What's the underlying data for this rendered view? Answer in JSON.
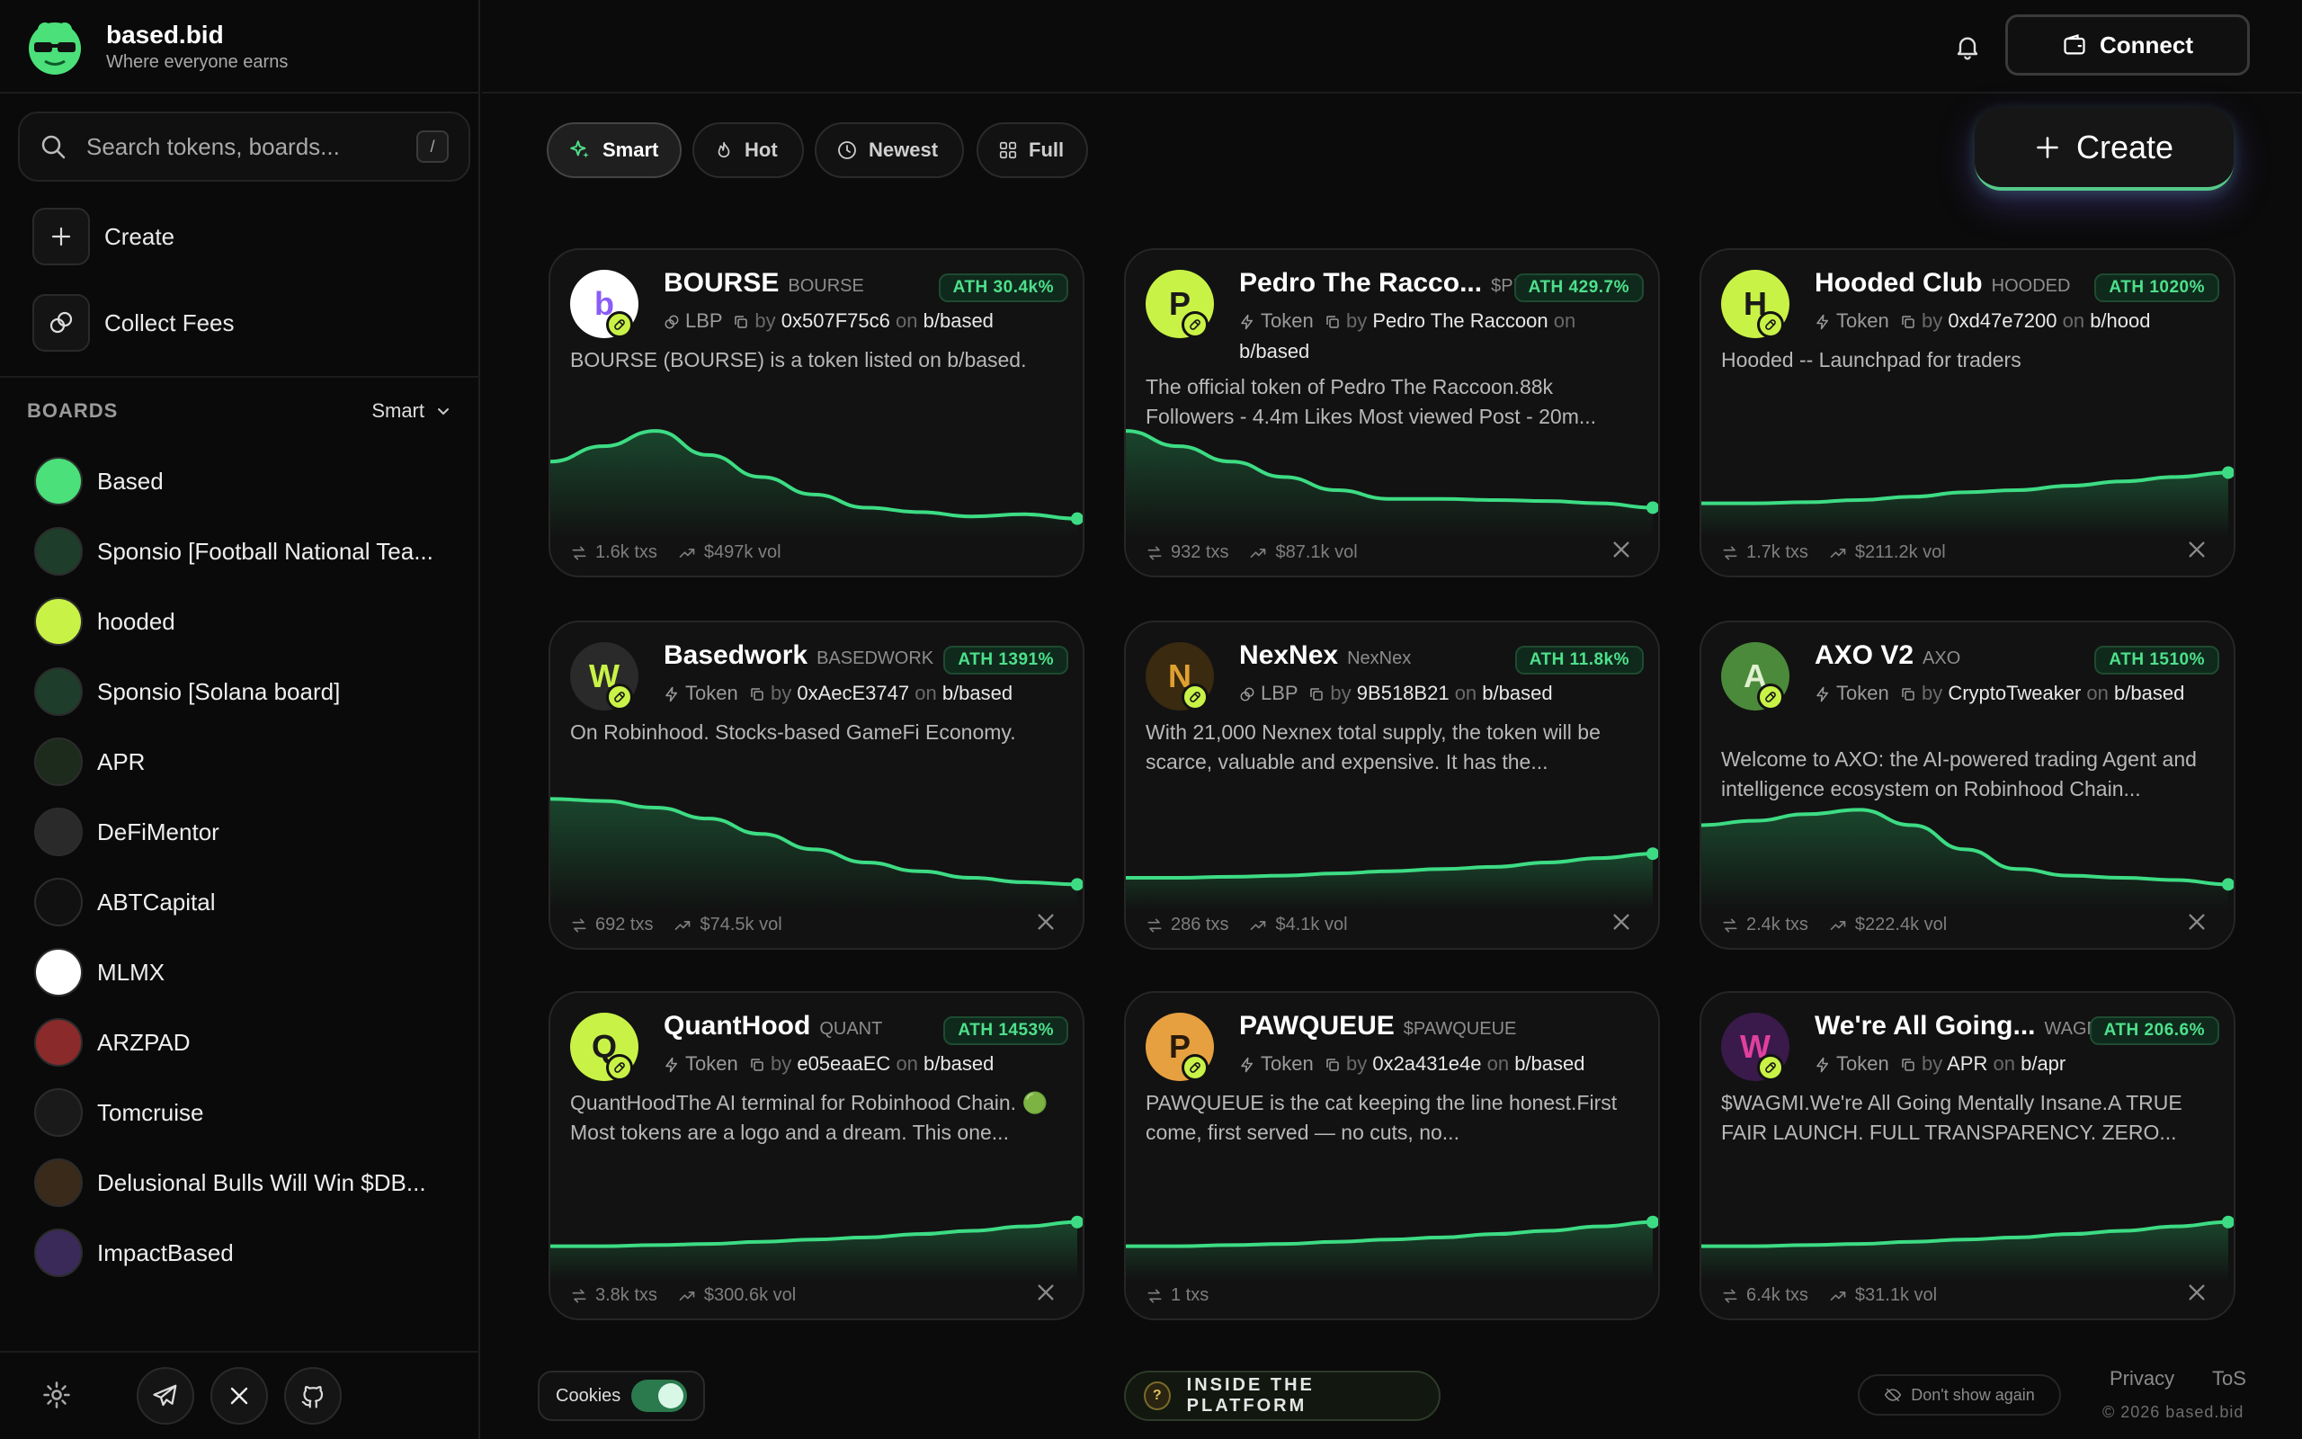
{
  "brand": {
    "name": "based.bid",
    "tagline": "Where everyone earns"
  },
  "header": {
    "connect_label": "Connect"
  },
  "sidebar": {
    "search_placeholder": "Search tokens, boards...",
    "search_shortcut": "/",
    "actions": [
      {
        "label": "Create",
        "icon": "plus-icon"
      },
      {
        "label": "Collect Fees",
        "icon": "coins-icon"
      }
    ],
    "boards_title": "BOARDS",
    "boards_sort": "Smart",
    "boards": [
      {
        "label": "Based",
        "color": "#4be07a"
      },
      {
        "label": "Sponsio [Football National Tea...",
        "color": "#1e3d2a"
      },
      {
        "label": "hooded",
        "color": "#c9f247"
      },
      {
        "label": "Sponsio [Solana board]",
        "color": "#1e3d2a"
      },
      {
        "label": "APR",
        "color": "#1c2b1c"
      },
      {
        "label": "DeFiMentor",
        "color": "#2a2a2a"
      },
      {
        "label": "ABTCapital",
        "color": "#111111"
      },
      {
        "label": "MLMX",
        "color": "#ffffff"
      },
      {
        "label": "ARZPAD",
        "color": "#8a2a2a"
      },
      {
        "label": "Tomcruise",
        "color": "#1a1a1a"
      },
      {
        "label": "Delusional Bulls Will Win $DB...",
        "color": "#3a2a1a"
      },
      {
        "label": "ImpactBased",
        "color": "#3a2a5a"
      }
    ]
  },
  "filters": [
    {
      "label": "Smart",
      "icon": "sparkle-icon",
      "active": true
    },
    {
      "label": "Hot",
      "icon": "flame-icon",
      "active": false
    },
    {
      "label": "Newest",
      "icon": "clock-icon",
      "active": false
    },
    {
      "label": "Full",
      "icon": "grid-icon",
      "active": false
    }
  ],
  "create_label": "Create",
  "cards": [
    {
      "name": "BOURSE",
      "symbol": "BOURSE",
      "ath": "ATH 30.4k%",
      "type": "LBP",
      "creator": "0x507F75c6",
      "board": "b/based",
      "desc": "BOURSE (BOURSE) is a token listed on b/based.",
      "txs": "1.6k txs",
      "vol": "$497k vol",
      "x": false,
      "logo_color": "#ffffff",
      "logo_letter": "b",
      "logo_text_color": "#8b5cf6",
      "spark": [
        0.58,
        0.72,
        0.86,
        0.64,
        0.44,
        0.28,
        0.16,
        0.12,
        0.08,
        0.1,
        0.06
      ]
    },
    {
      "name": "Pedro The Racco...",
      "symbol": "$PEDRO",
      "ath": "ATH 429.7%",
      "type": "Token",
      "creator": "Pedro The Raccoon",
      "board": "b/based",
      "desc": "The official token of Pedro The Raccoon.88k Followers - 4.4m Likes Most viewed Post - 20m...",
      "txs": "932 txs",
      "vol": "$87.1k vol",
      "x": true,
      "logo_color": "#c9f247",
      "logo_letter": "P",
      "logo_text_color": "#1a1a1a",
      "spark": [
        0.86,
        0.72,
        0.58,
        0.44,
        0.32,
        0.24,
        0.24,
        0.23,
        0.22,
        0.2,
        0.16
      ]
    },
    {
      "name": "Hooded Club",
      "symbol": "HOODED",
      "ath": "ATH 1020%",
      "type": "Token",
      "creator": "0xd47e7200",
      "board": "b/hood",
      "desc": "Hooded -- Launchpad for traders",
      "txs": "1.7k txs",
      "vol": "$211.2k vol",
      "x": true,
      "logo_color": "#c9f247",
      "logo_letter": "H",
      "logo_text_color": "#1a1a1a",
      "spark": [
        0.2,
        0.2,
        0.21,
        0.23,
        0.26,
        0.3,
        0.32,
        0.36,
        0.4,
        0.44,
        0.48
      ]
    },
    {
      "name": "Basedwork",
      "symbol": "BASEDWORK",
      "ath": "ATH 1391%",
      "type": "Token",
      "creator": "0xAecE3747",
      "board": "b/based",
      "desc": "On Robinhood. Stocks-based GameFi Economy.",
      "txs": "692 txs",
      "vol": "$74.5k vol",
      "x": true,
      "logo_color": "#2a2a2a",
      "logo_letter": "W",
      "logo_text_color": "#c9f247",
      "spark": [
        0.9,
        0.88,
        0.82,
        0.72,
        0.58,
        0.44,
        0.32,
        0.24,
        0.18,
        0.14,
        0.12
      ]
    },
    {
      "name": "NexNex",
      "symbol": "NexNex",
      "ath": "ATH 11.8k%",
      "type": "LBP",
      "creator": "9B518B21",
      "board": "b/based",
      "desc": "With 21,000 Nexnex total supply, the token will be scarce, valuable and expensive. It has the...",
      "txs": "286 txs",
      "vol": "$4.1k vol",
      "x": true,
      "logo_color": "#3a2a10",
      "logo_letter": "N",
      "logo_text_color": "#e0a030",
      "spark": [
        0.18,
        0.18,
        0.19,
        0.2,
        0.22,
        0.24,
        0.26,
        0.28,
        0.32,
        0.36,
        0.4
      ]
    },
    {
      "name": "AXO V2",
      "symbol": "AXO",
      "ath": "ATH 1510%",
      "type": "Token",
      "creator": "CryptoTweaker",
      "board": "b/based",
      "desc": "Welcome to AXO: the AI-powered trading Agent and intelligence ecosystem on Robinhood Chain...",
      "txs": "2.4k txs",
      "vol": "$222.4k vol",
      "x": true,
      "logo_color": "#4b8a3a",
      "logo_letter": "A",
      "logo_text_color": "#e0f0d0",
      "spark": [
        0.66,
        0.7,
        0.76,
        0.8,
        0.66,
        0.44,
        0.26,
        0.2,
        0.18,
        0.16,
        0.12
      ]
    },
    {
      "name": "QuantHood",
      "symbol": "QUANT",
      "ath": "ATH 1453%",
      "type": "Token",
      "creator": "e05eaaEC",
      "board": "b/based",
      "desc": "QuantHoodThe AI terminal for Robinhood Chain. 🟢 Most tokens are a logo and a dream. This one...",
      "txs": "3.8k txs",
      "vol": "$300.6k vol",
      "x": true,
      "logo_color": "#c9f247",
      "logo_letter": "Q",
      "logo_text_color": "#1a1a1a",
      "spark": [
        0.2,
        0.2,
        0.21,
        0.22,
        0.24,
        0.26,
        0.28,
        0.31,
        0.34,
        0.38,
        0.42
      ]
    },
    {
      "name": "PAWQUEUE",
      "symbol": "$PAWQUEUE",
      "ath": "",
      "type": "Token",
      "creator": "0x2a431e4e",
      "board": "b/based",
      "desc": "PAWQUEUE is the cat keeping the line honest.First come, first served — no cuts, no...",
      "txs": "1 txs",
      "vol": "",
      "x": false,
      "logo_color": "#e6a040",
      "logo_letter": "P",
      "logo_text_color": "#2a1a0a",
      "spark": [
        0.2,
        0.2,
        0.21,
        0.22,
        0.24,
        0.26,
        0.28,
        0.31,
        0.34,
        0.38,
        0.42
      ]
    },
    {
      "name": "We're All Going...",
      "symbol": "WAGMI",
      "ath": "ATH 206.6%",
      "type": "Token",
      "creator": "APR",
      "board": "b/apr",
      "desc": "$WAGMI.We're All Going Mentally Insane.A TRUE FAIR LAUNCH. FULL TRANSPARENCY. ZERO...",
      "txs": "6.4k txs",
      "vol": "$31.1k vol",
      "x": true,
      "logo_color": "#3a1a4a",
      "logo_letter": "W",
      "logo_text_color": "#e040a0",
      "spark": [
        0.2,
        0.2,
        0.21,
        0.22,
        0.24,
        0.26,
        0.28,
        0.31,
        0.34,
        0.38,
        0.42
      ]
    }
  ],
  "footer": {
    "cookies_label": "Cookies",
    "inside_label": "INSIDE THE PLATFORM",
    "inside_q": "?",
    "dont_show": "Don't show again",
    "privacy": "Privacy",
    "tos": "ToS",
    "copyright": "© 2026 based.bid"
  },
  "colors": {
    "accent_green": "#4ee08b",
    "lime": "#c9f247",
    "background": "#0b0b0b"
  }
}
